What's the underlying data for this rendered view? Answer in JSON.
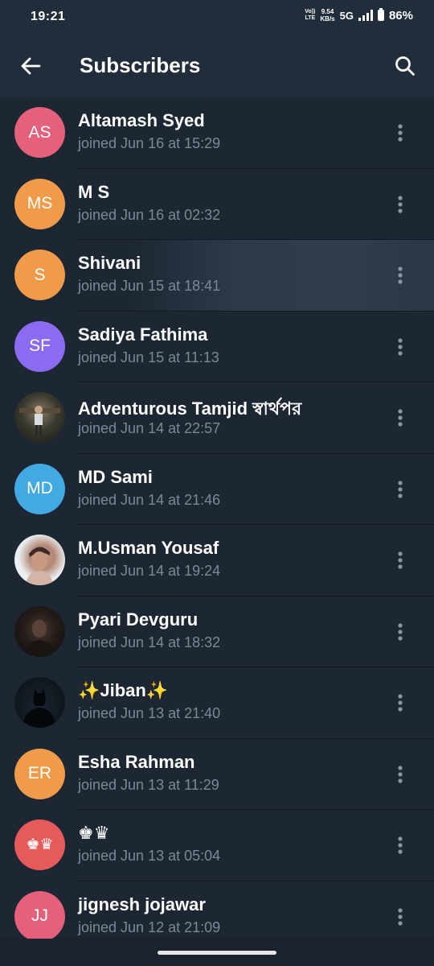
{
  "status_bar": {
    "time": "19:21",
    "volte_top": "Vo))",
    "volte_bottom": "LTE",
    "speed_value": "9.54",
    "speed_unit": "KB/s",
    "network": "5G",
    "battery": "86%"
  },
  "app_bar": {
    "title": "Subscribers",
    "back_icon": "arrow-left-icon",
    "search_icon": "search-icon"
  },
  "colors": {
    "background": "#1d2733",
    "header": "#212d3b",
    "secondary_text": "#7b8996"
  },
  "subscribers": [
    {
      "name": "Altamash Syed",
      "joined": "joined Jun 16 at 15:29",
      "initials": "AS",
      "avatar_color": "#e5607a",
      "avatar_type": "initials"
    },
    {
      "name": "M S",
      "joined": "joined Jun 16 at 02:32",
      "initials": "MS",
      "avatar_color": "#ef9b4b",
      "avatar_type": "initials"
    },
    {
      "name": "Shivani",
      "joined": "joined Jun 15 at 18:41",
      "initials": "S",
      "avatar_color": "#ef9b4b",
      "avatar_type": "initials"
    },
    {
      "name": "Sadiya Fathima",
      "joined": "joined Jun 15 at 11:13",
      "initials": "SF",
      "avatar_color": "#8b6cf0",
      "avatar_type": "initials"
    },
    {
      "name": "Adventurous Tamjid স্বার্থপর",
      "joined": "joined Jun 14 at 22:57",
      "initials": "",
      "avatar_color": "#3a3a30",
      "avatar_type": "photo"
    },
    {
      "name": "MD Sami",
      "joined": "joined Jun 14 at 21:46",
      "initials": "MD",
      "avatar_color": "#42a9e3",
      "avatar_type": "initials"
    },
    {
      "name": "M.Usman Yousaf",
      "joined": "joined Jun 14 at 19:24",
      "initials": "",
      "avatar_color": "#e9eef1",
      "avatar_type": "photo"
    },
    {
      "name": "Pyari Devguru",
      "joined": "joined Jun 14 at 18:32",
      "initials": "",
      "avatar_color": "#241c18",
      "avatar_type": "photo"
    },
    {
      "name": "✨Jiban✨",
      "joined": "joined Jun 13 at 21:40",
      "initials": "",
      "avatar_color": "#121a22",
      "avatar_type": "photo"
    },
    {
      "name": "Esha Rahman",
      "joined": "joined Jun 13 at 11:29",
      "initials": "ER",
      "avatar_color": "#ef9b4b",
      "avatar_type": "initials"
    },
    {
      "name": "♚♛",
      "joined": "joined Jun 13 at 05:04",
      "initials": "♚♛",
      "avatar_color": "#e55a5a",
      "avatar_type": "initials"
    },
    {
      "name": "jignesh jojawar",
      "joined": "joined Jun 12 at 21:09",
      "initials": "JJ",
      "avatar_color": "#e5607a",
      "avatar_type": "initials"
    }
  ]
}
